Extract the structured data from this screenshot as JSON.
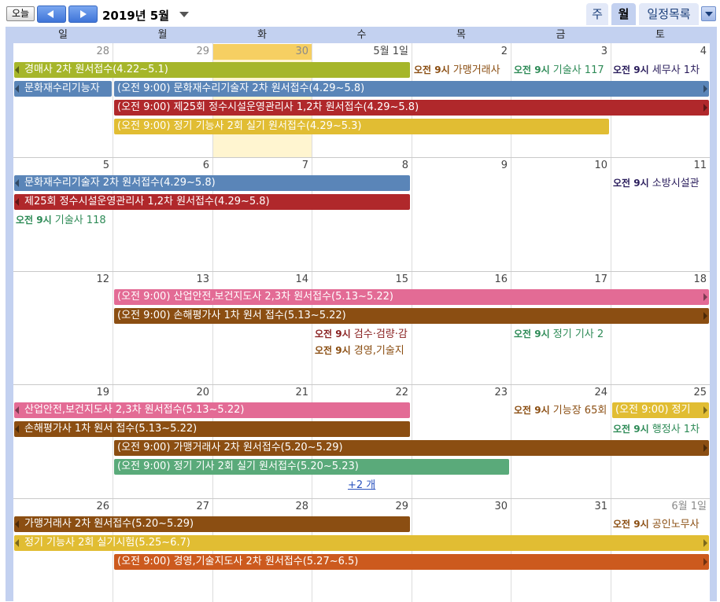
{
  "toolbar": {
    "today_label": "오늘",
    "title": "2019년 5월",
    "tabs": {
      "week": "주",
      "month": "월",
      "agenda": "일정목록"
    }
  },
  "weekdays": [
    "일",
    "월",
    "화",
    "수",
    "목",
    "금",
    "토"
  ],
  "weeks": [
    {
      "days": [
        "28",
        "29",
        "30",
        "5월 1일",
        "2",
        "3",
        "4"
      ]
    },
    {
      "days": [
        "5",
        "6",
        "7",
        "8",
        "9",
        "10",
        "11"
      ]
    },
    {
      "days": [
        "12",
        "13",
        "14",
        "15",
        "16",
        "17",
        "18"
      ]
    },
    {
      "days": [
        "19",
        "20",
        "21",
        "22",
        "23",
        "24",
        "25"
      ]
    },
    {
      "days": [
        "26",
        "27",
        "28",
        "29",
        "30",
        "31",
        "6월 1일"
      ]
    }
  ],
  "events": {
    "w1_a": "경매사 2차 원서접수(4.22~5.1)",
    "w1_b": "문화재수리기능자",
    "w1_c": "(오전 9:00) 문화재수리기술자 2차 원서접수(4.29~5.8)",
    "w1_d": "(오전 9:00) 제25회 정수시설운영관리사 1,2차 원서접수(4.29~5.8)",
    "w1_e": "(오전 9:00) 정기 기능사 2회 실기 원서접수(4.29~5.3)",
    "w1_s1_time": "오전 9시",
    "w1_s1_title": "가맹거래사",
    "w1_s2_time": "오전 9시",
    "w1_s2_title": "기술사 117",
    "w1_s3_time": "오전 9시",
    "w1_s3_title": "세무사 1차",
    "w2_a": "문화재수리기술자 2차 원서접수(4.29~5.8)",
    "w2_b": "제25회 정수시설운영관리사 1,2차 원서접수(4.29~5.8)",
    "w2_s1_time": "오전 9시",
    "w2_s1_title": "기술사 118",
    "w2_s2_time": "오전 9시",
    "w2_s2_title": "소방시설관",
    "w3_a": "(오전 9:00) 산업안전,보건지도사 2,3차 원서접수(5.13~5.22)",
    "w3_b": "(오전 9:00) 손해평가사 1차 원서 접수(5.13~5.22)",
    "w3_s1_time": "오전 9시",
    "w3_s1_title": "검수·검량·감",
    "w3_s2_time": "오전 9시",
    "w3_s2_title": "경영,기술지",
    "w3_s3_time": "오전 9시",
    "w3_s3_title": "정기 기사 2",
    "w4_a": "산업안전,보건지도사 2,3차 원서접수(5.13~5.22)",
    "w4_b": "손해평가사 1차 원서 접수(5.13~5.22)",
    "w4_c": "(오전 9:00) 가맹거래사 2차 원서접수(5.20~5.29)",
    "w4_d": "(오전 9:00) 정기 기사 2회 실기 원서접수(5.20~5.23)",
    "w4_e": "(오전 9:00) 정기",
    "w4_s1_time": "오전 9시",
    "w4_s1_title": "기능장 65회",
    "w4_s2_time": "오전 9시",
    "w4_s2_title": "행정사 1차",
    "w4_more": "+2 개",
    "w5_a": "가맹거래사 2차 원서접수(5.20~5.29)",
    "w5_b": "정기 기능사 2회 실기시험(5.25~6.7)",
    "w5_c": "(오전 9:00) 경영,기술지도사 2차 원서접수(5.27~6.5)",
    "w5_s1_time": "오전 9시",
    "w5_s1_title": "공인노무사"
  },
  "colors": {
    "olive": "#a6b62a",
    "steel": "#5a85b8",
    "crimson": "#b0282b",
    "mustard": "#e1bd33",
    "pink": "#e36b95",
    "brown": "#8b4e12",
    "green": "#5aaa7a",
    "orange": "#cc5a1e",
    "today": "#fff5d0",
    "header": "#c3d1f0"
  }
}
